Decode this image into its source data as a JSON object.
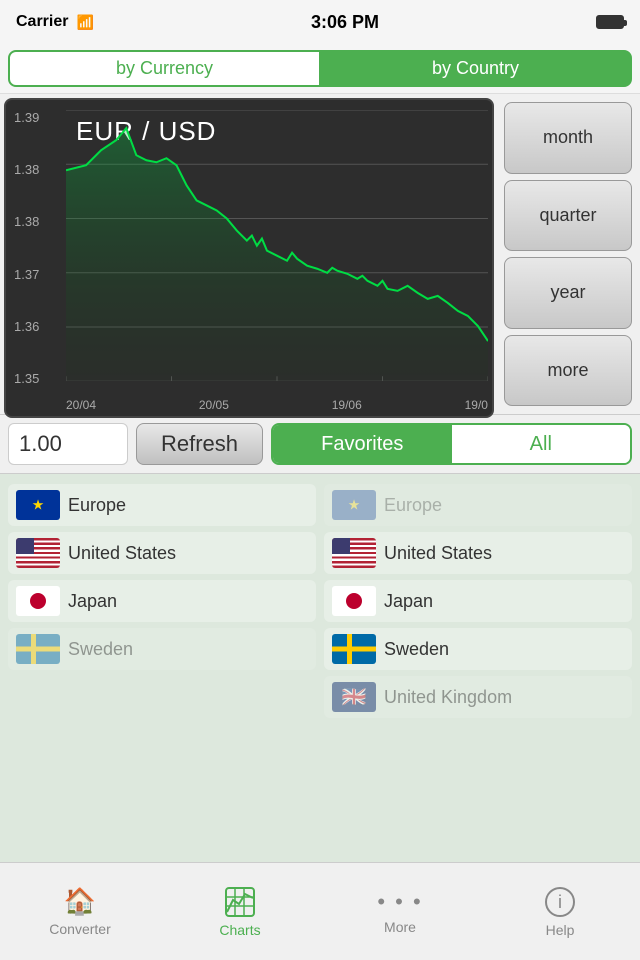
{
  "statusBar": {
    "carrier": "Carrier",
    "time": "3:06 PM"
  },
  "segmentControl": {
    "byCurrency": "by Currency",
    "byCountry": "by Country"
  },
  "chart": {
    "title": "EUR / USD",
    "yLabels": [
      "1.39",
      "1.38",
      "1.38",
      "1.37",
      "1.36",
      "1.35"
    ],
    "xLabels": [
      "20/04",
      "20/05",
      "19/06",
      "19/0"
    ]
  },
  "periodButtons": [
    {
      "label": "month",
      "id": "month"
    },
    {
      "label": "quarter",
      "id": "quarter"
    },
    {
      "label": "year",
      "id": "year"
    },
    {
      "label": "more",
      "id": "more"
    }
  ],
  "toolbar": {
    "amount": "1.00",
    "refreshLabel": "Refresh",
    "favoritesLabel": "Favorites",
    "allLabel": "All"
  },
  "leftColumn": [
    {
      "country": "Europe",
      "flag": "eu"
    },
    {
      "country": "United States",
      "flag": "us"
    },
    {
      "country": "Japan",
      "flag": "jp"
    },
    {
      "country": "Sweden",
      "flag": "se"
    }
  ],
  "rightColumn": [
    {
      "country": "Europe",
      "flag": "eu"
    },
    {
      "country": "United States",
      "flag": "us"
    },
    {
      "country": "Japan",
      "flag": "jp"
    },
    {
      "country": "Sweden",
      "flag": "se"
    },
    {
      "country": "United Kingdom",
      "flag": "gb"
    }
  ],
  "bottomNav": [
    {
      "label": "Converter",
      "icon": "🏠",
      "id": "converter",
      "active": false
    },
    {
      "label": "Charts",
      "icon": "📊",
      "id": "charts",
      "active": true
    },
    {
      "label": "More",
      "icon": "···",
      "id": "more",
      "active": false
    },
    {
      "label": "Help",
      "icon": "ℹ",
      "id": "help",
      "active": false
    }
  ]
}
